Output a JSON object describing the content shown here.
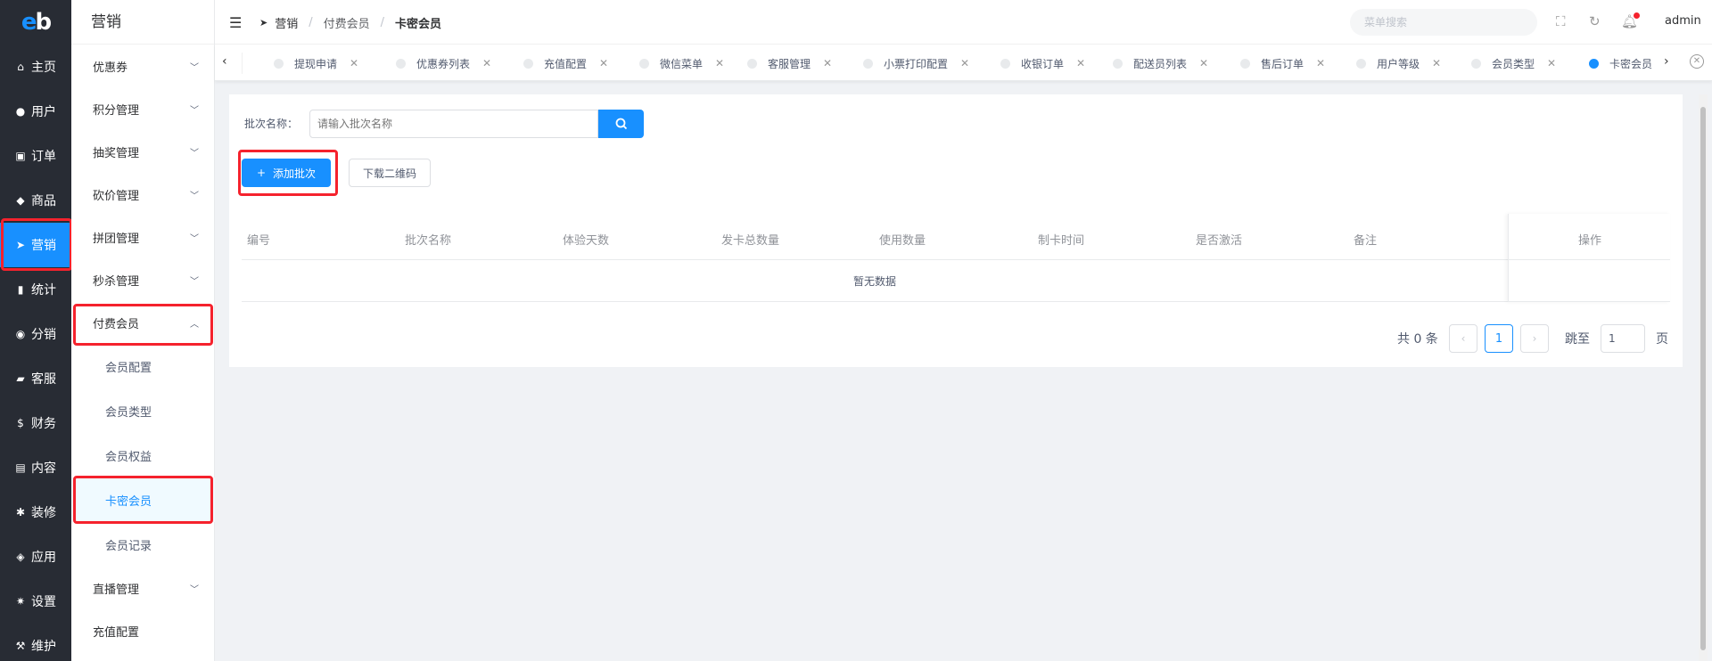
{
  "logo": "eb",
  "rail": [
    {
      "icon": "home-icon",
      "glyph": "⌂",
      "label": "主页"
    },
    {
      "icon": "user-icon",
      "glyph": "●",
      "label": "用户"
    },
    {
      "icon": "cart-icon",
      "glyph": "▣",
      "label": "订单"
    },
    {
      "icon": "shop-icon",
      "glyph": "◆",
      "label": "商品"
    },
    {
      "icon": "send-icon",
      "glyph": "➤",
      "label": "营销"
    },
    {
      "icon": "chart-icon",
      "glyph": "▮",
      "label": "统计"
    },
    {
      "icon": "share-icon",
      "glyph": "◉",
      "label": "分销"
    },
    {
      "icon": "chat-icon",
      "glyph": "▰",
      "label": "客服"
    },
    {
      "icon": "dollar-icon",
      "glyph": "$",
      "label": "财务"
    },
    {
      "icon": "book-icon",
      "glyph": "▤",
      "label": "内容"
    },
    {
      "icon": "brush-icon",
      "glyph": "✱",
      "label": "装修"
    },
    {
      "icon": "box-icon",
      "glyph": "◈",
      "label": "应用"
    },
    {
      "icon": "gear-icon",
      "glyph": "✷",
      "label": "设置"
    },
    {
      "icon": "hammer-icon",
      "glyph": "⚒",
      "label": "维护"
    }
  ],
  "submenu": {
    "title": "营销",
    "items": [
      "优惠券",
      "积分管理",
      "抽奖管理",
      "砍价管理",
      "拼团管理",
      "秒杀管理",
      "付费会员"
    ],
    "children": [
      "会员配置",
      "会员类型",
      "会员权益",
      "卡密会员",
      "会员记录"
    ],
    "after": [
      "直播管理",
      "充值配置"
    ]
  },
  "breadcrumb": {
    "root": "营销",
    "mid": "付费会员",
    "current": "卡密会员"
  },
  "header": {
    "search_placeholder": "菜单搜索",
    "user": "admin"
  },
  "tabs": [
    "提现申请",
    "优惠券列表",
    "充值配置",
    "微信菜单",
    "客服管理",
    "小票打印配置",
    "收银订单",
    "配送员列表",
    "售后订单",
    "用户等级",
    "会员类型",
    "卡密会员"
  ],
  "filter": {
    "label": "批次名称：",
    "placeholder": "请输入批次名称"
  },
  "buttons": {
    "add": "添加批次",
    "download": "下载二维码"
  },
  "table": {
    "columns": [
      "编号",
      "批次名称",
      "体验天数",
      "发卡总数量",
      "使用数量",
      "制卡时间",
      "是否激活",
      "备注"
    ],
    "action_column": "操作",
    "empty_text": "暂无数据"
  },
  "pagination": {
    "total_text": "共 0 条",
    "current_page": "1",
    "jump_label": "跳至",
    "jump_value": "1",
    "page_suffix": "页"
  },
  "colors": {
    "accent": "#1890ff",
    "sidebar": "#282c34",
    "highlight": "#f5222d"
  }
}
